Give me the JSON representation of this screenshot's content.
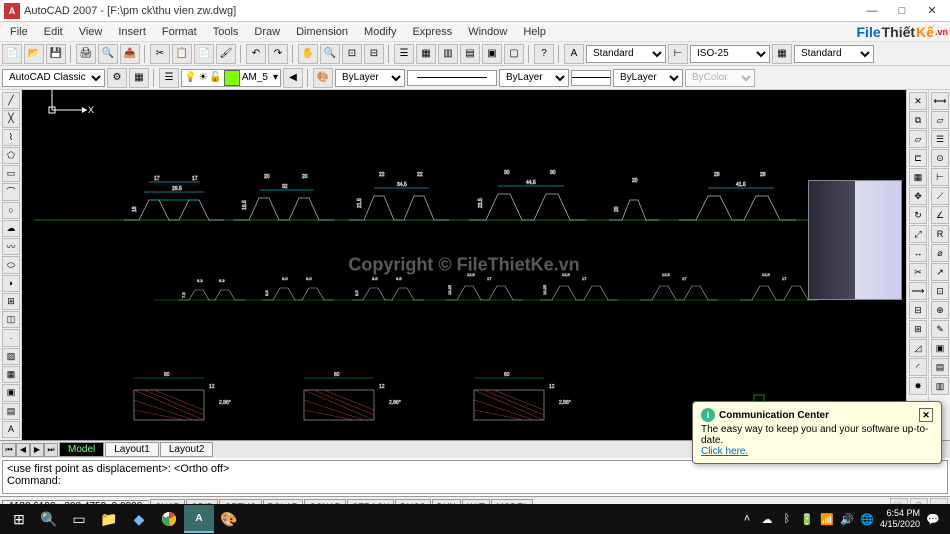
{
  "titlebar": {
    "app_icon_text": "A",
    "title": "AutoCAD 2007 - [F:\\pm ck\\thu vien zw.dwg]",
    "minimize": "—",
    "maximize": "□",
    "close": "✕"
  },
  "menubar": {
    "items": [
      "File",
      "Edit",
      "View",
      "Insert",
      "Format",
      "Tools",
      "Draw",
      "Dimension",
      "Modify",
      "Express",
      "Window",
      "Help"
    ],
    "branding": {
      "file": "File",
      "thiet": "Thiết",
      "ke": "Kế",
      "vn": ".vn"
    }
  },
  "toolbar1": {
    "style_a": "Standard",
    "style_b": "ISO-25",
    "style_c": "Standard"
  },
  "toolbar2": {
    "workspace": "AutoCAD Classic",
    "layer": "AM_5",
    "bylayer1": "ByLayer",
    "bylayer2": "ByLayer",
    "bylayer3": "ByLayer",
    "bycolor": "ByColor"
  },
  "tabs": {
    "nav": [
      "⏮",
      "◀",
      "▶",
      "⏭"
    ],
    "model": "Model",
    "layout1": "Layout1",
    "layout2": "Layout2"
  },
  "command": {
    "line1": "<use first point as displacement>:  <Ortho off>",
    "line2": "Command:"
  },
  "status": {
    "coords": "1128.6199, -398.4759, 0.0000",
    "toggles": [
      "SNAP",
      "GRID",
      "ORTHO",
      "POLAR",
      "OSNAP",
      "OTRACK",
      "DUCS",
      "DYN",
      "LWT",
      "MODEL"
    ]
  },
  "comm_popup": {
    "title": "Communication Center",
    "body": "The easy way to keep you and your software up-to-date.",
    "link": "Click here.",
    "close": "✕",
    "icon": "i"
  },
  "ucs": {
    "x": "X",
    "y": "Y"
  },
  "watermark": "Copyright © FileThietKe.vn",
  "taskbar": {
    "start": "⊞",
    "time": "6:54 PM",
    "date": "4/15/2020"
  },
  "drawing": {
    "row1_dims": [
      {
        "a": "17",
        "b": "29.5",
        "c": "17",
        "h": "18"
      },
      {
        "a": "20",
        "b": "32",
        "c": "20",
        "h": "19.5"
      },
      {
        "a": "22",
        "b": "34.5",
        "c": "22",
        "h": "21.5"
      },
      {
        "a": "30",
        "b": "44.5",
        "c": "30",
        "h": "23.5"
      },
      {
        "a": "20",
        "b": "",
        "c": "20",
        "h": "20"
      },
      {
        "a": "28",
        "b": "41.5",
        "c": "28",
        "h": ""
      }
    ],
    "row2_dims": [
      {
        "a": "6.3",
        "b": "",
        "c": "6.3",
        "h": "7.5"
      },
      {
        "a": "9.5",
        "b": "",
        "c": "9.5",
        "h": "8.5"
      },
      {
        "a": "9.5",
        "b": "",
        "c": "9.5",
        "h": "8.5"
      },
      {
        "a": "12.5",
        "b": "17",
        "c": "",
        "h": "10.25"
      },
      {
        "a": "12.5",
        "b": "17",
        "c": "",
        "h": "10.25"
      },
      {
        "a": "12.5",
        "b": "17",
        "c": "",
        "h": ""
      },
      {
        "a": "12.5",
        "b": "17",
        "c": "",
        "h": ""
      }
    ],
    "row3_dims": [
      {
        "w": "60",
        "d": "12",
        "ang": "2.86°"
      },
      {
        "w": "60",
        "d": "12",
        "ang": "2.86°"
      },
      {
        "w": "60",
        "d": "12",
        "ang": "2.86°"
      }
    ]
  }
}
